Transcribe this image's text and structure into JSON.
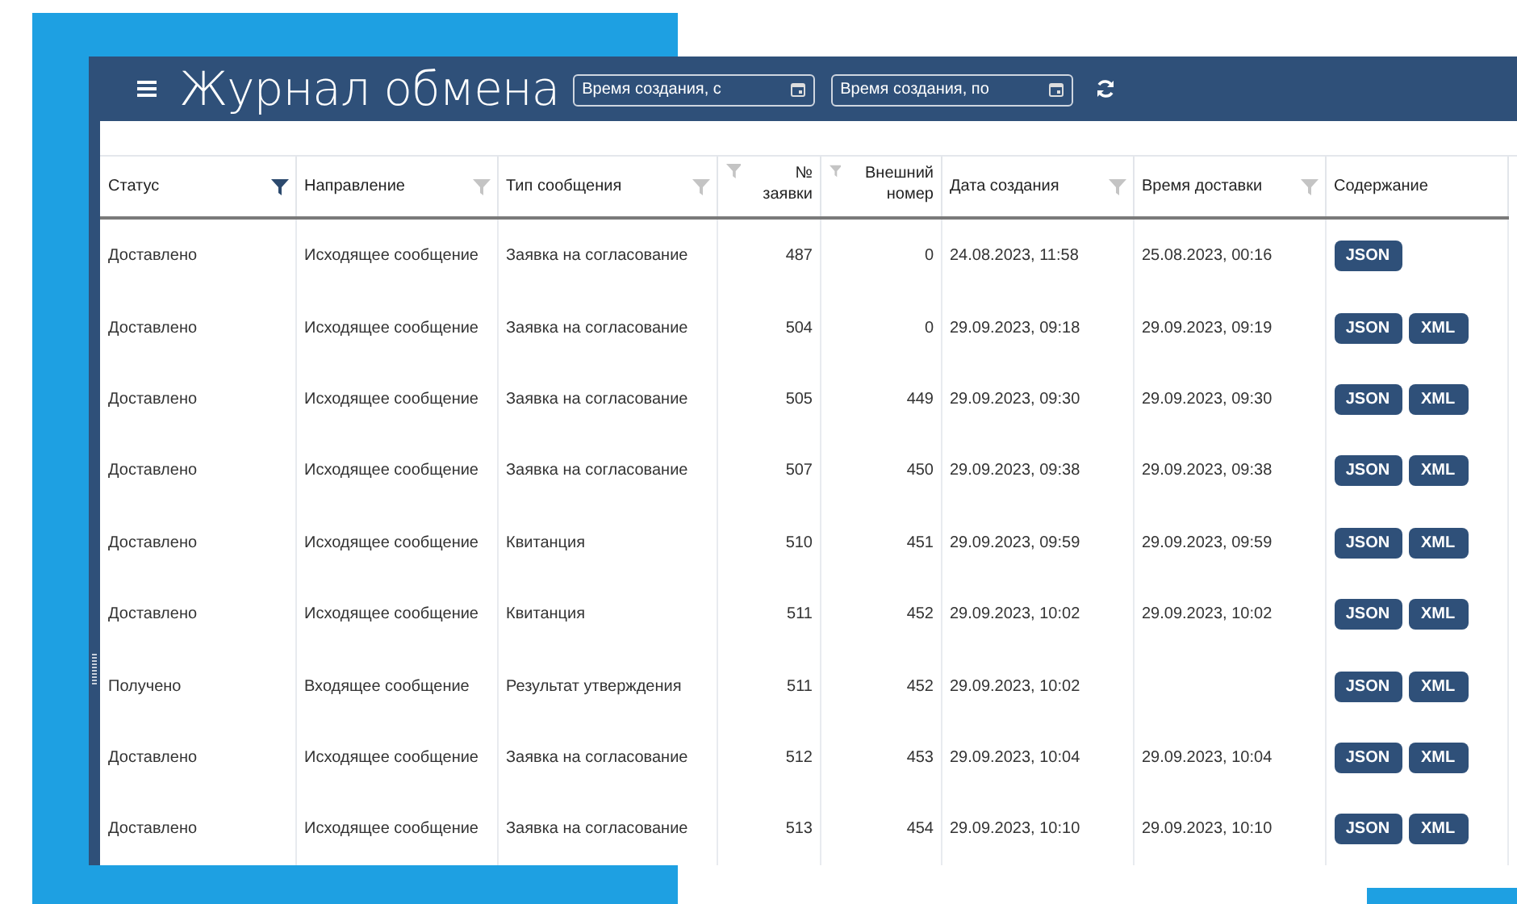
{
  "header": {
    "title": "Журнал обмена",
    "date_from": {
      "placeholder": "Время создания, с"
    },
    "date_to": {
      "placeholder": "Время создания, по"
    }
  },
  "table": {
    "columns": [
      {
        "label": "Статус",
        "kind": "text",
        "filter_active": true
      },
      {
        "label": "Направление",
        "kind": "text",
        "filter_active": false
      },
      {
        "label": "Тип сообщения",
        "kind": "text",
        "filter_active": false
      },
      {
        "label": "№ заявки",
        "kind": "number",
        "filter_active": false
      },
      {
        "label": "Внешний номер",
        "kind": "number",
        "filter_active": false
      },
      {
        "label": "Дата создания",
        "kind": "text",
        "filter_active": false
      },
      {
        "label": "Время доставки",
        "kind": "text",
        "filter_active": false
      },
      {
        "label": "Содержание",
        "kind": "buttons"
      }
    ],
    "rows": [
      {
        "status": "Доставлено",
        "direction": "Исходящее сообщение",
        "type": "Заявка на согласование",
        "request_no": "487",
        "external_no": "0",
        "created": "24.08.2023, 11:58",
        "delivered": "25.08.2023, 00:16",
        "formats": [
          "JSON"
        ]
      },
      {
        "status": "Доставлено",
        "direction": "Исходящее сообщение",
        "type": "Заявка на согласование",
        "request_no": "504",
        "external_no": "0",
        "created": "29.09.2023, 09:18",
        "delivered": "29.09.2023, 09:19",
        "formats": [
          "JSON",
          "XML"
        ]
      },
      {
        "status": "Доставлено",
        "direction": "Исходящее сообщение",
        "type": "Заявка на согласование",
        "request_no": "505",
        "external_no": "449",
        "created": "29.09.2023, 09:30",
        "delivered": "29.09.2023, 09:30",
        "formats": [
          "JSON",
          "XML"
        ]
      },
      {
        "status": "Доставлено",
        "direction": "Исходящее сообщение",
        "type": "Заявка на согласование",
        "request_no": "507",
        "external_no": "450",
        "created": "29.09.2023, 09:38",
        "delivered": "29.09.2023, 09:38",
        "formats": [
          "JSON",
          "XML"
        ]
      },
      {
        "status": "Доставлено",
        "direction": "Исходящее сообщение",
        "type": "Квитанция",
        "request_no": "510",
        "external_no": "451",
        "created": "29.09.2023, 09:59",
        "delivered": "29.09.2023, 09:59",
        "formats": [
          "JSON",
          "XML"
        ]
      },
      {
        "status": "Доставлено",
        "direction": "Исходящее сообщение",
        "type": "Квитанция",
        "request_no": "511",
        "external_no": "452",
        "created": "29.09.2023, 10:02",
        "delivered": "29.09.2023, 10:02",
        "formats": [
          "JSON",
          "XML"
        ]
      },
      {
        "status": "Получено",
        "direction": "Входящее сообщение",
        "type": "Результат утверждения",
        "request_no": "511",
        "external_no": "452",
        "created": "29.09.2023, 10:02",
        "formats": [
          "JSON",
          "XML"
        ]
      },
      {
        "status": "Доставлено",
        "direction": "Исходящее сообщение",
        "type": "Заявка на согласование",
        "request_no": "512",
        "external_no": "453",
        "created": "29.09.2023, 10:04",
        "delivered": "29.09.2023, 10:04",
        "formats": [
          "JSON",
          "XML"
        ]
      },
      {
        "status": "Доставлено",
        "direction": "Исходящее сообщение",
        "type": "Заявка на согласование",
        "request_no": "513",
        "external_no": "454",
        "created": "29.09.2023, 10:10",
        "delivered": "29.09.2023, 10:10",
        "formats": [
          "JSON",
          "XML"
        ]
      }
    ]
  }
}
